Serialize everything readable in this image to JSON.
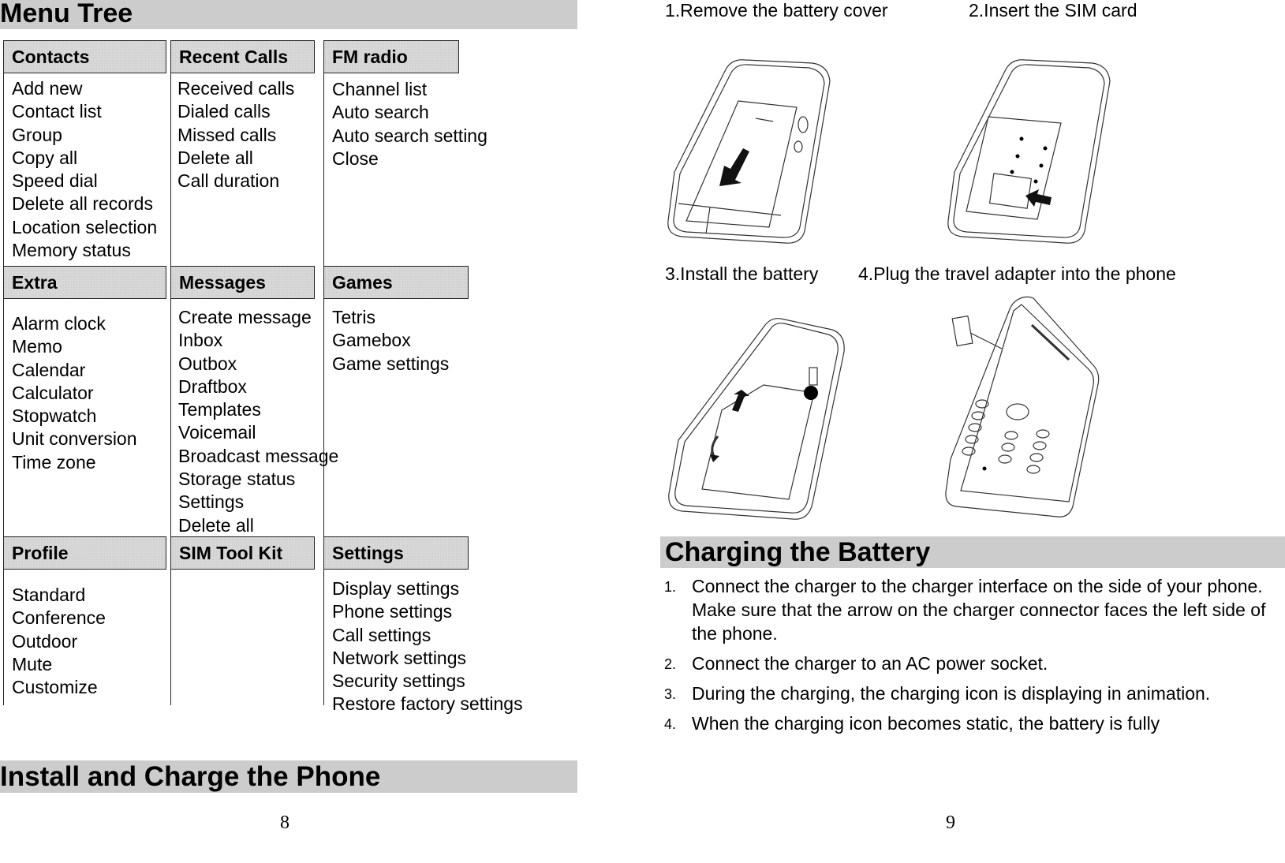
{
  "left_page": {
    "title": "Menu Tree",
    "menus": [
      {
        "header": "Contacts",
        "items": [
          "Add new",
          "Contact list",
          "Group",
          "Copy all",
          "Speed dial",
          "Delete all records",
          "Location selection",
          "Memory status"
        ]
      },
      {
        "header": "Recent Calls",
        "items": [
          "Received calls",
          "Dialed calls",
          "Missed calls",
          "Delete all",
          "Call duration"
        ]
      },
      {
        "header": "FM radio",
        "items": [
          "Channel list",
          "Auto search",
          "Auto search setting",
          "Close"
        ]
      },
      {
        "header": "Extra",
        "items": [
          "Alarm clock",
          "Memo",
          "Calendar",
          "Calculator",
          "Stopwatch",
          "Unit conversion",
          "Time zone"
        ]
      },
      {
        "header": "Messages",
        "items": [
          "Create message",
          "Inbox",
          "Outbox",
          "Draftbox",
          "Templates",
          "Voicemail",
          "Broadcast message",
          "Storage status",
          "Settings",
          "Delete all"
        ]
      },
      {
        "header": "Games",
        "items": [
          "Tetris",
          "Gamebox",
          "Game settings"
        ]
      },
      {
        "header": "Profile",
        "items": [
          "Standard",
          "Conference",
          "Outdoor",
          "Mute",
          "Customize"
        ]
      },
      {
        "header": "SIM Tool Kit",
        "items": []
      },
      {
        "header": "Settings",
        "items": [
          "Display settings",
          "Phone settings",
          "Call settings",
          "Network settings",
          "Security settings",
          "Restore factory settings"
        ]
      }
    ],
    "section_title": "Install and Charge the Phone",
    "page_number": "8"
  },
  "right_page": {
    "steps": [
      {
        "caption": "1.Remove the battery cover",
        "illustration": "phone-back-cover-removal"
      },
      {
        "caption": "2.Insert the SIM card",
        "illustration": "sim-card-insertion"
      },
      {
        "caption": "3.Install the battery",
        "illustration": "battery-installation"
      },
      {
        "caption": "4.Plug the travel adapter into the phone",
        "illustration": "travel-adapter-plug"
      }
    ],
    "section_title": "Charging the Battery",
    "list": [
      {
        "num": "1.",
        "text": "Connect the charger to the charger interface on the side of your phone.",
        "extra": "Make sure that the arrow on the charger connector faces the left side of the phone."
      },
      {
        "num": "2.",
        "text": "Connect the charger to an AC power socket."
      },
      {
        "num": "3.",
        "text": "During the charging, the charging icon is displaying in animation."
      },
      {
        "num": "4.",
        "text": "When the charging icon becomes static, the battery is fully"
      }
    ],
    "page_number": "9"
  }
}
